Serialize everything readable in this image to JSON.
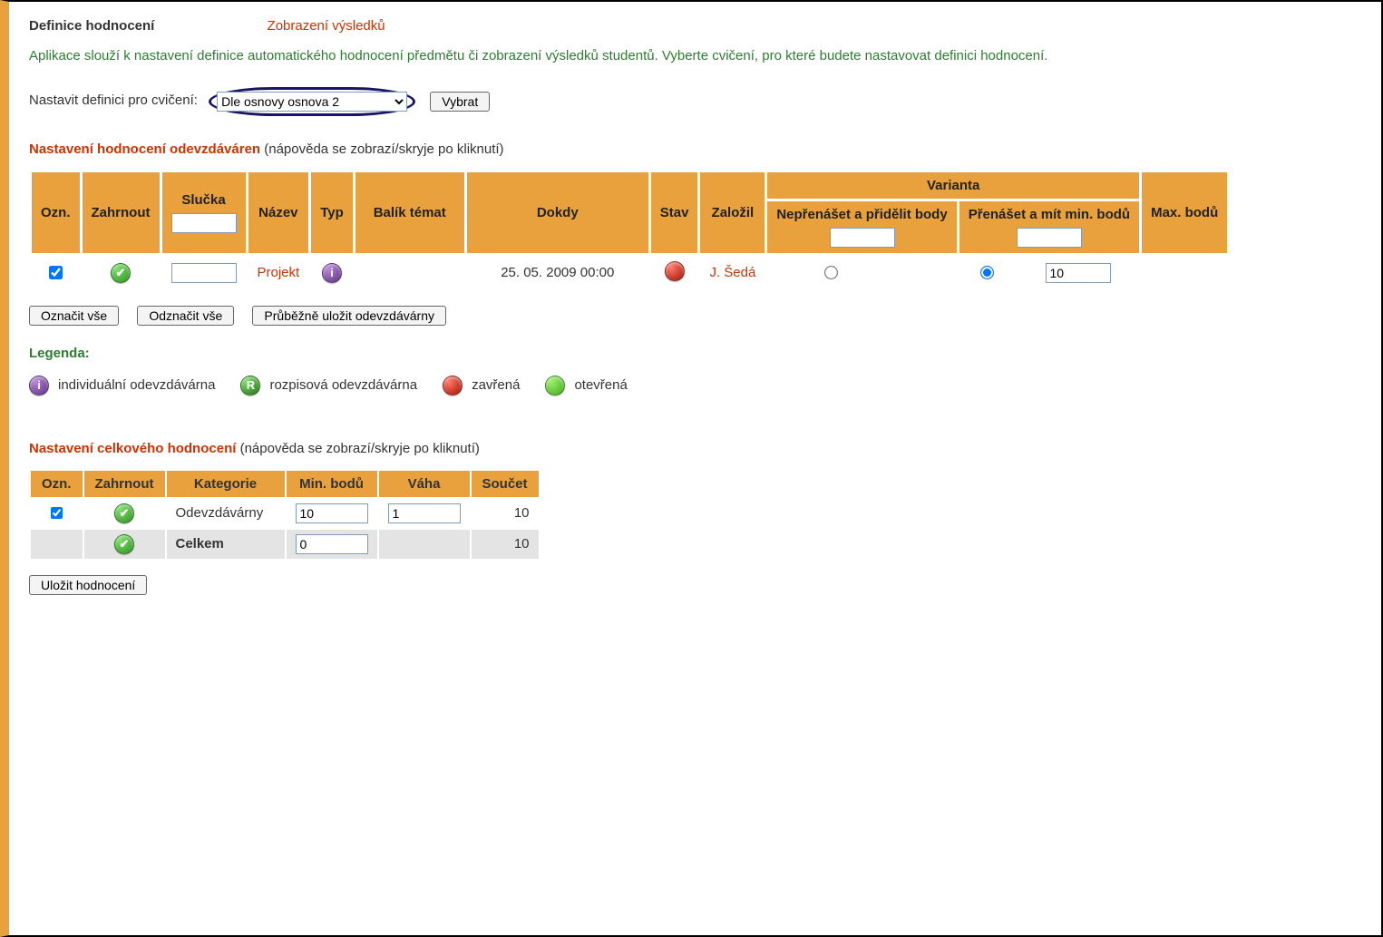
{
  "tabs": {
    "active": "Definice hodnocení",
    "other": "Zobrazení výsledků"
  },
  "intro": "Aplikace slouží k nastavení definice automatického hodnocení předmětu či zobrazení výsledků studentů. Vyberte cvičení, pro které budete nastavovat definici hodnocení.",
  "selector": {
    "label": "Nastavit definici pro cvičení:",
    "option": "Dle osnovy osnova 2",
    "button": "Vybrat"
  },
  "section1": {
    "title": "Nastavení hodnocení odevzdáváren",
    "hint": "(nápověda se zobrazí/skryje po kliknutí)",
    "headers": {
      "ozn": "Ozn.",
      "zahrnout": "Zahrnout",
      "slucka": "Slučka",
      "nazev": "Název",
      "typ": "Typ",
      "balik": "Balík témat",
      "dokdy": "Dokdy",
      "stav": "Stav",
      "zalozil": "Založil",
      "varianta": "Varianta",
      "var_a": "Nepřenášet a přidělit body",
      "var_b": "Přenášet a mít min. bodů",
      "max": "Max. bodů"
    },
    "row": {
      "nazev": "Projekt",
      "dokdy": "25. 05. 2009 00:00",
      "zalozil": "J. Šedá",
      "var_b_value": "10"
    },
    "buttons": {
      "select_all": "Označit vše",
      "deselect_all": "Odznačit vše",
      "save": "Průběžně uložit odevzdávárny"
    }
  },
  "legend": {
    "title": "Legenda:",
    "individual": "individuální odevzdávárna",
    "rozpisova": "rozpisová odevzdávárna",
    "closed": "zavřená",
    "open": "otevřená"
  },
  "section2": {
    "title": "Nastavení celkového hodnocení",
    "hint": "(nápověda se zobrazí/skryje po kliknutí)",
    "headers": {
      "ozn": "Ozn.",
      "zahrnout": "Zahrnout",
      "kategorie": "Kategorie",
      "min": "Min. bodů",
      "vaha": "Váha",
      "soucet": "Součet"
    },
    "rows": {
      "r1": {
        "kategorie": "Odevzdávárny",
        "min": "10",
        "vaha": "1",
        "soucet": "10"
      },
      "r2": {
        "kategorie": "Celkem",
        "min": "0",
        "soucet": "10"
      }
    },
    "save": "Uložit hodnocení"
  }
}
